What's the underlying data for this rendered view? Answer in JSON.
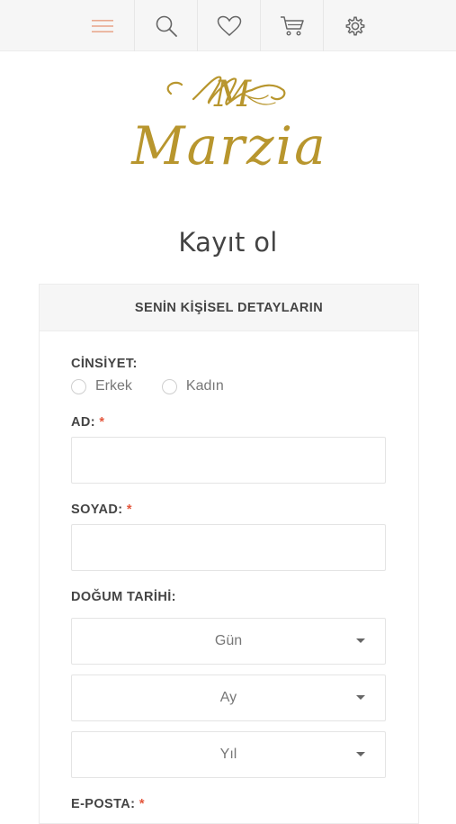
{
  "nav": {
    "items": [
      {
        "name": "menu-icon"
      },
      {
        "name": "search-icon"
      },
      {
        "name": "heart-icon"
      },
      {
        "name": "cart-icon"
      },
      {
        "name": "gear-icon"
      }
    ],
    "accent_color": "#e9a98f"
  },
  "logo": {
    "monogram": "M",
    "text": "Marzia",
    "color": "#b8962e"
  },
  "page": {
    "title": "Kayıt ol"
  },
  "panel": {
    "heading": "SENİN KİŞİSEL DETAYLARIN"
  },
  "form": {
    "gender_label": "CİNSİYET:",
    "gender_options": [
      "Erkek",
      "Kadın"
    ],
    "first_name_label": "AD:",
    "last_name_label": "SOYAD:",
    "birthdate_label": "DOĞUM TARİHİ:",
    "day_placeholder": "Gün",
    "month_placeholder": "Ay",
    "year_placeholder": "Yıl",
    "email_label": "E-POSTA:",
    "required_mark": "*",
    "required_color": "#e4573d"
  }
}
